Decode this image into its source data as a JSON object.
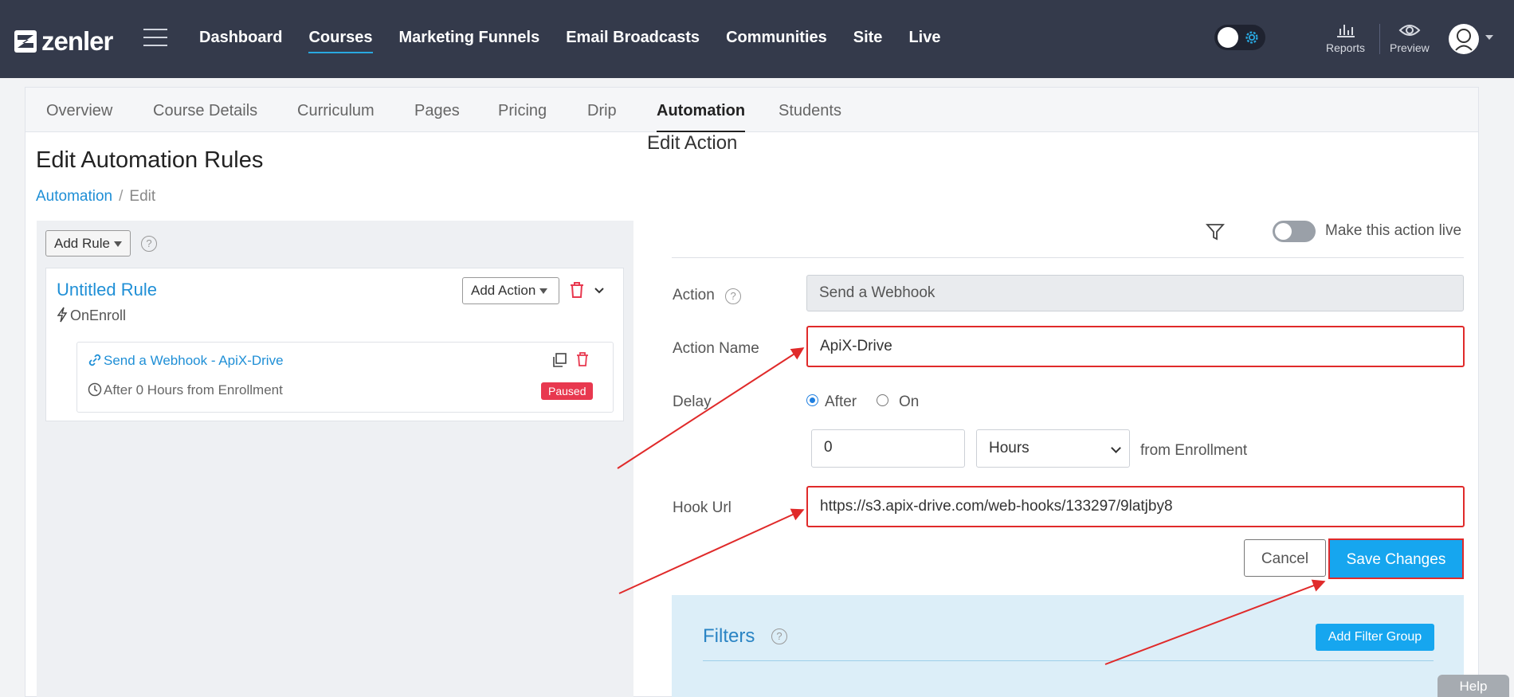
{
  "brand": {
    "name": "zenler"
  },
  "nav": [
    "Dashboard",
    "Courses",
    "Marketing Funnels",
    "Email Broadcasts",
    "Communities",
    "Site",
    "Live"
  ],
  "nav_active": "Courses",
  "top_right": {
    "reports_label": "Reports",
    "preview_label": "Preview"
  },
  "tabs": [
    "Overview",
    "Course Details",
    "Curriculum",
    "Pages",
    "Pricing",
    "Drip",
    "Automation",
    "Students"
  ],
  "tab_active": "Automation",
  "page": {
    "title": "Edit Automation Rules",
    "breadcrumb": {
      "link": "Automation",
      "separator": "/",
      "current": "Edit"
    }
  },
  "rules": {
    "add_rule_label": "Add Rule",
    "help": "?",
    "rule": {
      "title": "Untitled Rule",
      "trigger": "OnEnroll",
      "add_action_label": "Add Action",
      "action": {
        "link": "Send a Webhook - ApiX-Drive",
        "timing": "After 0 Hours from Enrollment",
        "status": "Paused"
      }
    }
  },
  "edit_action": {
    "title": "Edit Action",
    "live_label": "Make this action live",
    "live": false,
    "action_label": "Action",
    "action_value": "Send a Webhook",
    "action_name_label": "Action Name",
    "action_name_value": "ApiX-Drive",
    "delay_label": "Delay",
    "delay_after": "After",
    "delay_on": "On",
    "delay_selected": "After",
    "delay_amount": "0",
    "delay_unit": "Hours",
    "delay_suffix": "from Enrollment",
    "hook_url_label": "Hook Url",
    "hook_url_value": "https://s3.apix-drive.com/web-hooks/133297/9latjby8",
    "cancel_label": "Cancel",
    "save_label": "Save Changes"
  },
  "filters": {
    "title": "Filters",
    "help": "?",
    "add_group_label": "Add Filter Group"
  },
  "help_tab": "Help",
  "colors": {
    "nav_bg": "#343a4b",
    "accent": "#16a6ef",
    "link": "#1f8fd6",
    "danger": "#e8384f",
    "annotation": "#e02a2a"
  }
}
